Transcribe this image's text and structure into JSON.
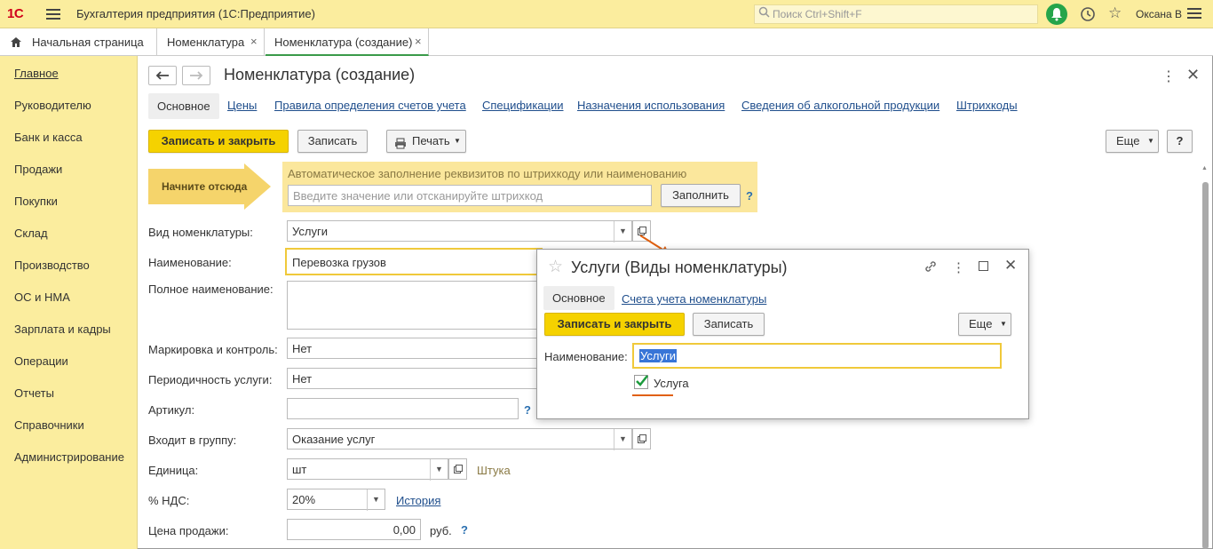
{
  "app": {
    "logo": "1С",
    "title": "Бухгалтерия предприятия  (1С:Предприятие)",
    "search_placeholder": "Поиск Ctrl+Shift+F",
    "user": "Оксана В"
  },
  "tabs": [
    {
      "label": "Начальная страница"
    },
    {
      "label": "Номенклатура",
      "close": "×"
    },
    {
      "label": "Номенклатура (создание)",
      "close": "×"
    }
  ],
  "sidebar": {
    "items": [
      {
        "label": "Главное"
      },
      {
        "label": "Руководителю"
      },
      {
        "label": "Банк и касса"
      },
      {
        "label": "Продажи"
      },
      {
        "label": "Покупки"
      },
      {
        "label": "Склад"
      },
      {
        "label": "Производство"
      },
      {
        "label": "ОС и НМА"
      },
      {
        "label": "Зарплата и кадры"
      },
      {
        "label": "Операции"
      },
      {
        "label": "Отчеты"
      },
      {
        "label": "Справочники"
      },
      {
        "label": "Администрирование"
      }
    ]
  },
  "form": {
    "title": "Номенклатура (создание)",
    "tabs": [
      "Основное",
      "Цены",
      "Правила определения счетов учета",
      "Спецификации",
      "Назначения использования",
      "Сведения об алкогольной продукции",
      "Штрихкоды"
    ],
    "buttons": {
      "save_close": "Записать и закрыть",
      "save": "Записать",
      "print": "Печать",
      "more": "Еще",
      "help": "?"
    },
    "hint": {
      "arrow_label": "Начните отсюда",
      "text": "Автоматическое заполнение реквизитов по штрихкоду или наименованию",
      "placeholder": "Введите значение или отсканируйте штрихкод",
      "fill_button": "Заполнить",
      "help": "?"
    },
    "fields": {
      "kind_label": "Вид номенклатуры:",
      "kind_value": "Услуги",
      "name_label": "Наименование:",
      "name_value": "Перевозка грузов",
      "fullname_label": "Полное наименование:",
      "marking_label": "Маркировка и контроль:",
      "marking_value": "Нет",
      "period_label": "Периодичность услуги:",
      "period_value": "Нет",
      "article_label": "Артикул:",
      "article_help": "?",
      "group_label": "Входит в группу:",
      "group_value": "Оказание услуг",
      "unit_label": "Единица:",
      "unit_value": "шт",
      "unit_desc": "Штука",
      "vat_label": "% НДС:",
      "vat_value": "20%",
      "vat_history": "История",
      "price_label": "Цена продажи:",
      "price_value": "0,00",
      "price_currency": "руб.",
      "price_help": "?"
    }
  },
  "popup": {
    "title": "Услуги (Виды номенклатуры)",
    "tabs": [
      "Основное",
      "Счета учета номенклатуры"
    ],
    "save_close": "Записать и закрыть",
    "save": "Записать",
    "more": "Еще",
    "name_label": "Наименование:",
    "name_value": "Услуги",
    "checkbox_label": "Услуга",
    "checkbox_checked": true
  },
  "colors": {
    "accent_yellow": "#f5d200",
    "panel_yellow": "#fbed9e",
    "link_blue": "#1f4e8c",
    "annotation_orange": "#e06010"
  }
}
